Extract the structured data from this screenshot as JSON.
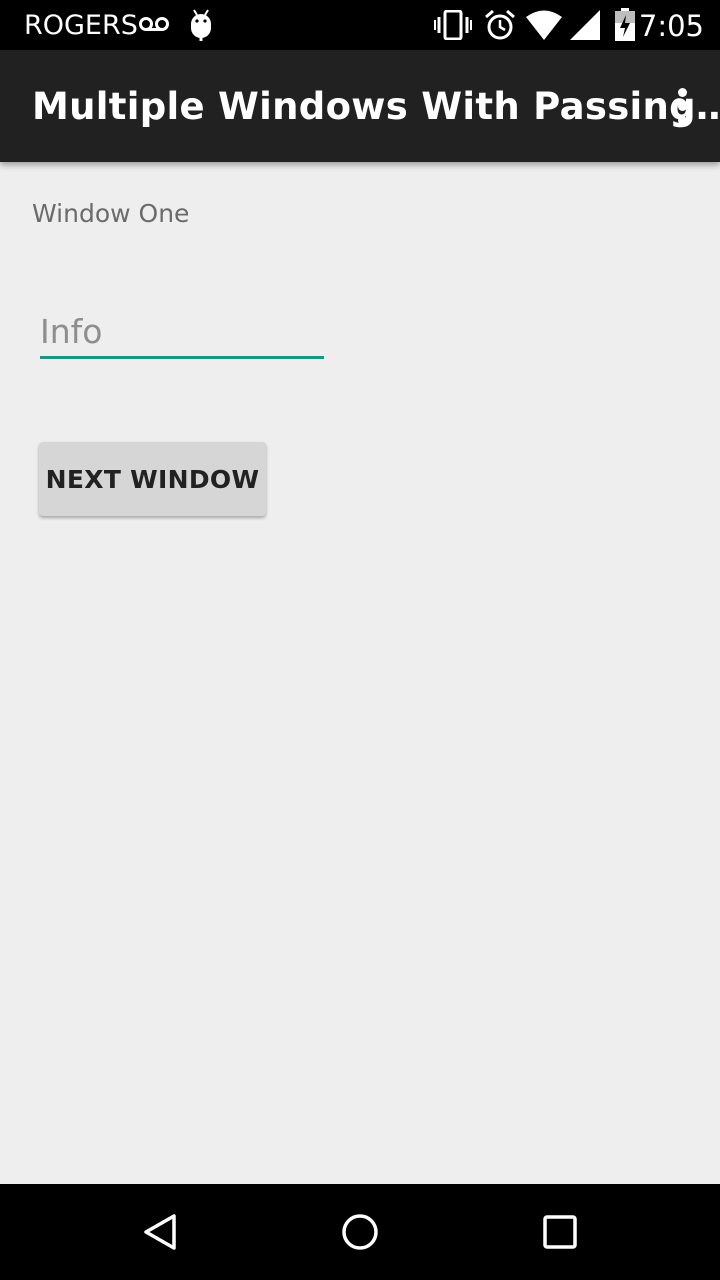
{
  "status_bar": {
    "carrier": "ROGERS",
    "time": "7:05",
    "icons": [
      "voicemail-icon",
      "android-debug-icon",
      "vibrate-icon",
      "alarm-icon",
      "wifi-icon",
      "signal-icon",
      "battery-charging-icon"
    ]
  },
  "app_bar": {
    "title": "Multiple Windows With Passing…",
    "overflow_icon": "more-vert-icon"
  },
  "main": {
    "window_label": "Window One",
    "info_placeholder": "Info",
    "info_value": "",
    "next_button_label": "NEXT WINDOW"
  },
  "nav_bar": {
    "buttons": [
      "back-icon",
      "home-icon",
      "recents-icon"
    ]
  },
  "colors": {
    "status_bar": "#000000",
    "app_bar": "#212121",
    "background": "#eeeeee",
    "accent": "#1e9488",
    "button": "#d6d6d6"
  }
}
